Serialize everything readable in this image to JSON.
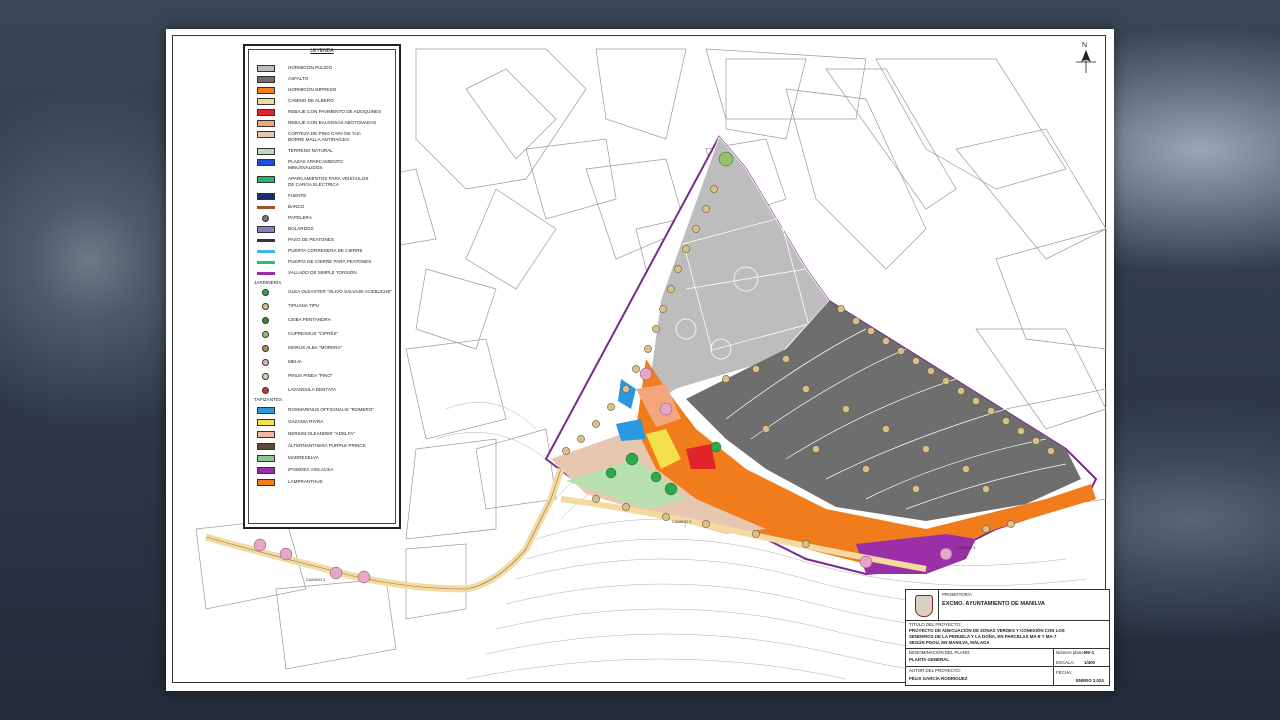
{
  "legend": {
    "title": "LEYENDA",
    "items": [
      {
        "label": "HORMIGÓN PULIDO",
        "color": "#bdbdbd",
        "kind": "rect"
      },
      {
        "label": "ASFALTO",
        "color": "#6e6e6e",
        "kind": "rect"
      },
      {
        "label": "HORMIGÓN IMPRESO",
        "color": "#f07c1c",
        "kind": "rect"
      },
      {
        "label": "CAMINO DE ALBERO",
        "color": "#f4d9a0",
        "kind": "rect"
      },
      {
        "label": "REBAJE CON PAVIMENTO DE ADOQUINES",
        "color": "#e0242a",
        "kind": "rect"
      },
      {
        "label": "REBAJE CON BALDOSAS ABOTONADAS",
        "color": "#f3a57c",
        "kind": "rect"
      },
      {
        "label": "CORTEZA DE PINO CAPA DE 7cm",
        "color": "#e8c7b0",
        "kind": "rect"
      },
      {
        "label": "BORRE MALLA ANTIRAÍCES",
        "color": "#e8c7b0",
        "kind": "none"
      },
      {
        "label": "TERRENO NATURAL",
        "color": "#b8e0b0",
        "kind": "rect"
      },
      {
        "label": "PLAZAS APARCAMIENTO",
        "color": "#1f4fd6",
        "kind": "rect"
      },
      {
        "label": "MINUSVALIDOS",
        "color": "#1f4fd6",
        "kind": "none"
      },
      {
        "label": "APARCAMIENTOS PARA VEHÍCULOS",
        "color": "#26b36a",
        "kind": "icon"
      },
      {
        "label": "DE CARGA ELÉCTRICA",
        "color": "#26b36a",
        "kind": "none"
      },
      {
        "label": "FUENTE",
        "color": "#1a2b6e",
        "kind": "icon"
      },
      {
        "label": "BANCO",
        "color": "#a0522d",
        "kind": "line"
      },
      {
        "label": "PAPELERA",
        "color": "#777777",
        "kind": "circ"
      },
      {
        "label": "BOLARDOS",
        "color": "#8a7fc0",
        "kind": "icon"
      },
      {
        "label": "PASO DE PEATONES",
        "color": "#333333",
        "kind": "line"
      },
      {
        "label": "PUERTA CORREDERA DE CIERRE",
        "color": "#3fb5e0",
        "kind": "line"
      },
      {
        "label": "PUERTA DE CIERRE PARA PEATONES",
        "color": "#2fbf6a",
        "kind": "line"
      },
      {
        "label": "VALLADO DE SIMPLE TORSIÓN",
        "color": "#9b2fa8",
        "kind": "line"
      }
    ],
    "jardineria_head": "JARDINERÍA",
    "plants": [
      {
        "label": "OLEA OLEASTER \"OLIVO SALVAJE-ACEBUCHE\"",
        "color": "#2fa84a"
      },
      {
        "label": "TIPUANA TIPU",
        "color": "#d8c08a"
      },
      {
        "label": "CEIBA PENTANDRA",
        "color": "#2f8a3a"
      },
      {
        "label": "CUPRESSUS \"CIPRÉS\"",
        "color": "#9bbf6a"
      },
      {
        "label": "MORUS ALBA \"MORERA\"",
        "color": "#b08a50"
      },
      {
        "label": "MELIA",
        "color": "#e6a6c6"
      },
      {
        "label": "PINUS PINEA \"PINO\"",
        "color": "#c8d8b0"
      },
      {
        "label": "LAVANDULA DENTATA",
        "color": "#d03030"
      }
    ],
    "tapizantes_head": "TAPIZANTES",
    "covers": [
      {
        "label": "ROSMARINUS OFFICINALIS \"ROMERO\"",
        "color": "#2a98e0"
      },
      {
        "label": "GAZANIA RIVRA",
        "color": "#f4e04a"
      },
      {
        "label": "NERIUM OLEANDER \"ADELFA\"",
        "color": "#f2b8a0"
      },
      {
        "label": "ALTERNANTHERA PURPLE PRINCE",
        "color": "#5a4a3a"
      },
      {
        "label": "MADRESELVA",
        "color": "#8ac890"
      },
      {
        "label": "IPOMOEA VIOLACEA",
        "color": "#9b2fa8"
      },
      {
        "label": "LAMPRANTHUS",
        "color": "#f07c1c"
      }
    ]
  },
  "map": {
    "north": "N",
    "camino_labels": [
      "CAMINO 1",
      "CAMINO 2",
      "CAMINO 3"
    ],
    "colors": {
      "hormigon_pulido": "#bdbdbd",
      "asfalto": "#6e6e6e",
      "hormigon_impreso": "#f07c1c",
      "albero": "#f4d9a0",
      "natural": "#b8e0b0",
      "corteza": "#e8c7b0",
      "violacea": "#9b2fa8",
      "fence": "#7a2a8a"
    }
  },
  "titleblock": {
    "promotor_label": "PROMOTOR/A",
    "promotor": "EXCMO. AYUNTAMIENTO DE MANILVA",
    "titulo_label": "TITULO DEL PROYECTO:",
    "titulo": [
      "PROYECTO DE ADECUACIÓN DE ZONAS VERDES Y CONEXIÓN CON LOS",
      "SENDEROS DE LA PERUELA Y LA DOÑA, EN PARCELAS MA-8 Y MA-7",
      "SEGÚN PGOU, EN MANILVA, MÁLAGA"
    ],
    "plano_label": "DENOMINACIÓN DEL PLANO:",
    "plano": "PLANTA GENERAL",
    "autor_label": "AUTOR DEL PROYECTO:",
    "autor": "FÉLIX GARCÍA RODRÍGUEZ",
    "numero_label": "Número plano:",
    "numero": "MV-1",
    "escala_label": "ESCALA:",
    "escala": "1/400",
    "fecha_label": "FECHA:",
    "fecha": "ENERO 2.024"
  }
}
